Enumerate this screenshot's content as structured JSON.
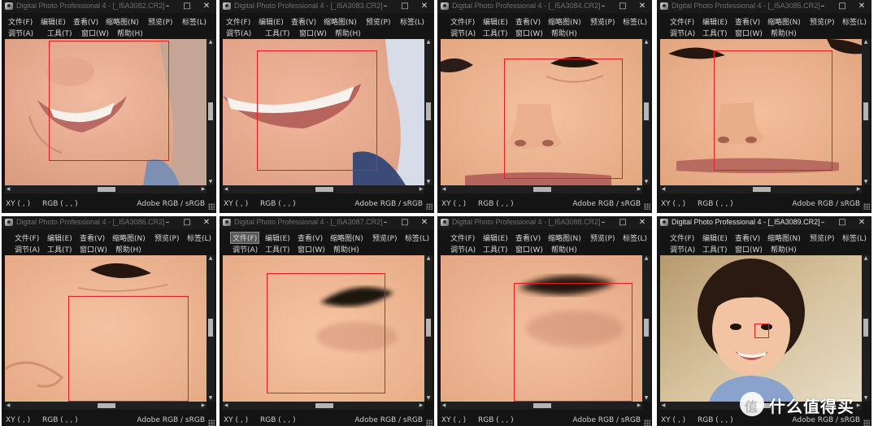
{
  "colors": {
    "window_bg": "#141414",
    "focus_box": "#e31e1e",
    "title_inactive": "#6f6f6f",
    "title_active": "#e4e4e4"
  },
  "menu": {
    "file": "文件(F)",
    "edit": "编辑(E)",
    "view": "查看(V)",
    "thumbnail": "缩略图(N)",
    "preview": "预览(P)",
    "tab": "标签(L)",
    "adjust": "调节(A)",
    "tools": "工具(T)",
    "window": "窗口(W)",
    "help": "帮助(H)"
  },
  "status": {
    "xy": "XY (    ,    )",
    "rgb": "RGB (    ,    ,    )",
    "profile": "Adobe RGB / sRGB"
  },
  "window_controls": {
    "minimize": "–",
    "maximize": "□",
    "close": "✕"
  },
  "windows": [
    {
      "title": "Digital Photo Professional 4 - [_I5A3082.CR2]",
      "subject": "mouth-smile"
    },
    {
      "title": "Digital Photo Professional 4 - [_I5A3083.CR2]",
      "subject": "mouth-smile"
    },
    {
      "title": "Digital Photo Professional 4 - [_I5A3084.CR2]",
      "subject": "nose-eyes"
    },
    {
      "title": "Digital Photo Professional 4 - [_I5A3085.CR2]",
      "subject": "nose-eyes"
    },
    {
      "title": "Digital Photo Professional 4 - [_I5A3086.CR2]",
      "subject": "eye-cheek"
    },
    {
      "title": "Digital Photo Professional 4 - [_I5A3087.CR2]",
      "subject": "eye-closeup"
    },
    {
      "title": "Digital Photo Professional 4 - [_I5A3088.CR2]",
      "subject": "eye-closeup"
    },
    {
      "title": "Digital Photo Professional 4 - [_I5A3089.CR2]",
      "subject": "girl-portrait"
    }
  ],
  "watermark": {
    "text": "什么值得买"
  }
}
